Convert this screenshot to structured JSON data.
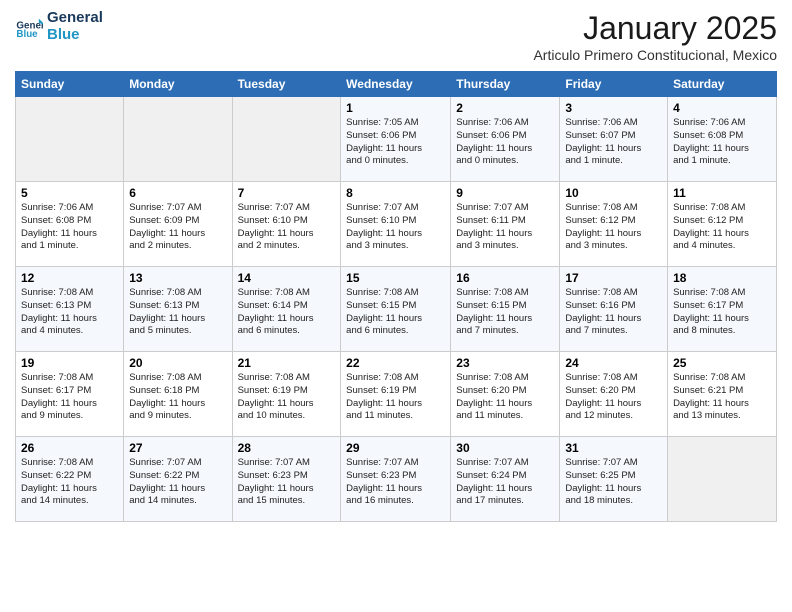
{
  "logo": {
    "text_general": "General",
    "text_blue": "Blue"
  },
  "title": "January 2025",
  "subtitle": "Articulo Primero Constitucional, Mexico",
  "days_header": [
    "Sunday",
    "Monday",
    "Tuesday",
    "Wednesday",
    "Thursday",
    "Friday",
    "Saturday"
  ],
  "weeks": [
    [
      {
        "num": "",
        "info": ""
      },
      {
        "num": "",
        "info": ""
      },
      {
        "num": "",
        "info": ""
      },
      {
        "num": "1",
        "info": "Sunrise: 7:05 AM\nSunset: 6:06 PM\nDaylight: 11 hours\nand 0 minutes."
      },
      {
        "num": "2",
        "info": "Sunrise: 7:06 AM\nSunset: 6:06 PM\nDaylight: 11 hours\nand 0 minutes."
      },
      {
        "num": "3",
        "info": "Sunrise: 7:06 AM\nSunset: 6:07 PM\nDaylight: 11 hours\nand 1 minute."
      },
      {
        "num": "4",
        "info": "Sunrise: 7:06 AM\nSunset: 6:08 PM\nDaylight: 11 hours\nand 1 minute."
      }
    ],
    [
      {
        "num": "5",
        "info": "Sunrise: 7:06 AM\nSunset: 6:08 PM\nDaylight: 11 hours\nand 1 minute."
      },
      {
        "num": "6",
        "info": "Sunrise: 7:07 AM\nSunset: 6:09 PM\nDaylight: 11 hours\nand 2 minutes."
      },
      {
        "num": "7",
        "info": "Sunrise: 7:07 AM\nSunset: 6:10 PM\nDaylight: 11 hours\nand 2 minutes."
      },
      {
        "num": "8",
        "info": "Sunrise: 7:07 AM\nSunset: 6:10 PM\nDaylight: 11 hours\nand 3 minutes."
      },
      {
        "num": "9",
        "info": "Sunrise: 7:07 AM\nSunset: 6:11 PM\nDaylight: 11 hours\nand 3 minutes."
      },
      {
        "num": "10",
        "info": "Sunrise: 7:08 AM\nSunset: 6:12 PM\nDaylight: 11 hours\nand 3 minutes."
      },
      {
        "num": "11",
        "info": "Sunrise: 7:08 AM\nSunset: 6:12 PM\nDaylight: 11 hours\nand 4 minutes."
      }
    ],
    [
      {
        "num": "12",
        "info": "Sunrise: 7:08 AM\nSunset: 6:13 PM\nDaylight: 11 hours\nand 4 minutes."
      },
      {
        "num": "13",
        "info": "Sunrise: 7:08 AM\nSunset: 6:13 PM\nDaylight: 11 hours\nand 5 minutes."
      },
      {
        "num": "14",
        "info": "Sunrise: 7:08 AM\nSunset: 6:14 PM\nDaylight: 11 hours\nand 6 minutes."
      },
      {
        "num": "15",
        "info": "Sunrise: 7:08 AM\nSunset: 6:15 PM\nDaylight: 11 hours\nand 6 minutes."
      },
      {
        "num": "16",
        "info": "Sunrise: 7:08 AM\nSunset: 6:15 PM\nDaylight: 11 hours\nand 7 minutes."
      },
      {
        "num": "17",
        "info": "Sunrise: 7:08 AM\nSunset: 6:16 PM\nDaylight: 11 hours\nand 7 minutes."
      },
      {
        "num": "18",
        "info": "Sunrise: 7:08 AM\nSunset: 6:17 PM\nDaylight: 11 hours\nand 8 minutes."
      }
    ],
    [
      {
        "num": "19",
        "info": "Sunrise: 7:08 AM\nSunset: 6:17 PM\nDaylight: 11 hours\nand 9 minutes."
      },
      {
        "num": "20",
        "info": "Sunrise: 7:08 AM\nSunset: 6:18 PM\nDaylight: 11 hours\nand 9 minutes."
      },
      {
        "num": "21",
        "info": "Sunrise: 7:08 AM\nSunset: 6:19 PM\nDaylight: 11 hours\nand 10 minutes."
      },
      {
        "num": "22",
        "info": "Sunrise: 7:08 AM\nSunset: 6:19 PM\nDaylight: 11 hours\nand 11 minutes."
      },
      {
        "num": "23",
        "info": "Sunrise: 7:08 AM\nSunset: 6:20 PM\nDaylight: 11 hours\nand 11 minutes."
      },
      {
        "num": "24",
        "info": "Sunrise: 7:08 AM\nSunset: 6:20 PM\nDaylight: 11 hours\nand 12 minutes."
      },
      {
        "num": "25",
        "info": "Sunrise: 7:08 AM\nSunset: 6:21 PM\nDaylight: 11 hours\nand 13 minutes."
      }
    ],
    [
      {
        "num": "26",
        "info": "Sunrise: 7:08 AM\nSunset: 6:22 PM\nDaylight: 11 hours\nand 14 minutes."
      },
      {
        "num": "27",
        "info": "Sunrise: 7:07 AM\nSunset: 6:22 PM\nDaylight: 11 hours\nand 14 minutes."
      },
      {
        "num": "28",
        "info": "Sunrise: 7:07 AM\nSunset: 6:23 PM\nDaylight: 11 hours\nand 15 minutes."
      },
      {
        "num": "29",
        "info": "Sunrise: 7:07 AM\nSunset: 6:23 PM\nDaylight: 11 hours\nand 16 minutes."
      },
      {
        "num": "30",
        "info": "Sunrise: 7:07 AM\nSunset: 6:24 PM\nDaylight: 11 hours\nand 17 minutes."
      },
      {
        "num": "31",
        "info": "Sunrise: 7:07 AM\nSunset: 6:25 PM\nDaylight: 11 hours\nand 18 minutes."
      },
      {
        "num": "",
        "info": ""
      }
    ]
  ]
}
